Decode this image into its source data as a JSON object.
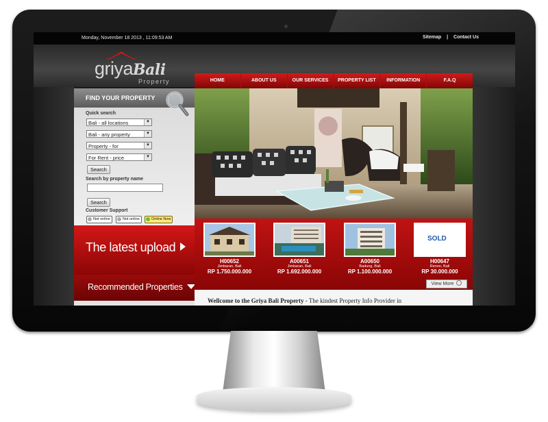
{
  "topbar": {
    "datetime": "Monday, November 18 2013 , 11:09:53 AM",
    "sitemap": "Sitemap",
    "separator": "|",
    "contact": "Contact Us"
  },
  "logo": {
    "main": "griya",
    "accent": "Bali",
    "sub": "Property"
  },
  "nav": [
    "HOME",
    "ABOUT US",
    "OUR SERVICES",
    "PROPERTY LIST",
    "INFORMATION",
    "F.A.Q"
  ],
  "search": {
    "title": "FIND YOUR PROPERTY",
    "quick_label": "Quick search",
    "selects": [
      "Bali - all locations",
      "Bali - any property",
      "Property - for",
      "For Rent - price"
    ],
    "search_button": "Search",
    "name_label": "Search by property name",
    "name_value": "",
    "search_button2": "Search",
    "support_label": "Customer Support",
    "support": [
      "Not online",
      "Not online",
      "Online Now"
    ]
  },
  "latest_upload": "The latest upload",
  "recommended": "Recommended Properties",
  "listings": [
    {
      "code": "H00652",
      "location": "Jimbaran, Bali",
      "price": "RP 1.750.000.000"
    },
    {
      "code": "A00651",
      "location": "Jimbaran, Bali",
      "price": "RP 1.692.000.000"
    },
    {
      "code": "A00650",
      "location": "Badung, Bali",
      "price": "RP 1.100.000.000"
    },
    {
      "code": "H00647",
      "location": "Renon, Bali",
      "price": "RP 30.000.000",
      "badge": "SOLD"
    }
  ],
  "view_more": "View More",
  "welcome": {
    "bold": "Wellcome to the Griya Bali Property -",
    "rest": " The kindest Property Info Provider in"
  },
  "colors": {
    "brand_red": "#c01313",
    "dark_red": "#8a0505",
    "topbar": "#050505"
  }
}
